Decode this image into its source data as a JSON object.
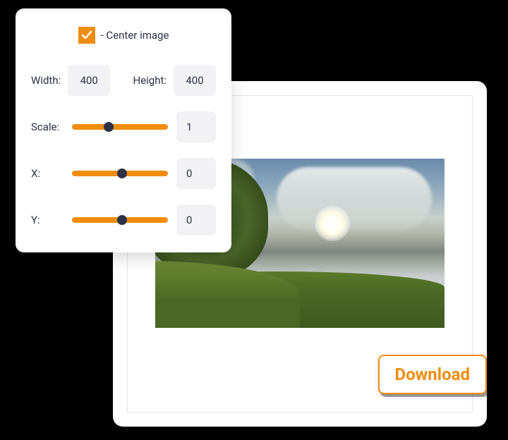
{
  "controls": {
    "center_image": {
      "label": "- Center image",
      "checked": true
    },
    "width": {
      "label": "Width:",
      "value": "400"
    },
    "height": {
      "label": "Height:",
      "value": "400"
    },
    "scale": {
      "label": "Scale:",
      "value": "1",
      "position": 38
    },
    "x": {
      "label": "X:",
      "value": "0",
      "position": 52
    },
    "y": {
      "label": "Y:",
      "value": "0",
      "position": 52
    }
  },
  "download": {
    "label": "Download"
  },
  "colors": {
    "accent": "#ef8d11",
    "text": "#2c3145",
    "input_bg": "#f2f2f4"
  }
}
